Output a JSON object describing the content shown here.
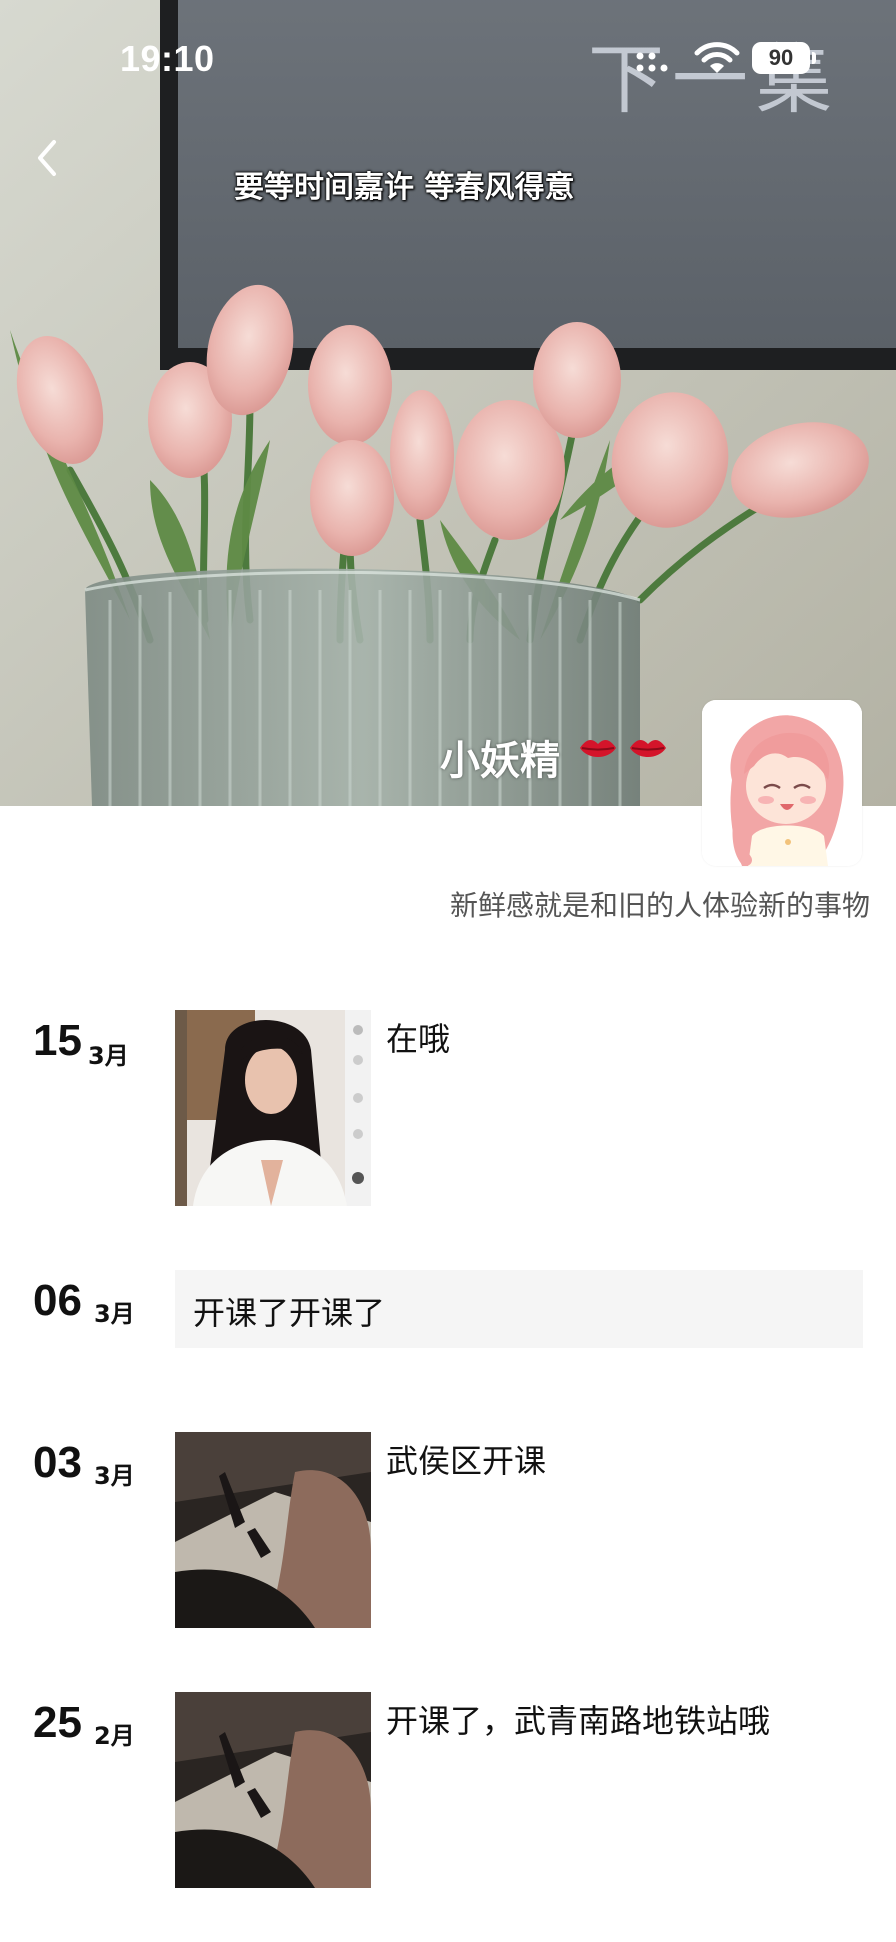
{
  "status_bar": {
    "time": "19:10",
    "battery": "90",
    "watermark": "下一集"
  },
  "cover": {
    "caption": "要等时间嘉许 等春风得意",
    "name": "小妖精"
  },
  "profile": {
    "signature": "新鲜感就是和旧的人体验新的事物"
  },
  "posts": [
    {
      "day": "15",
      "month": "3月",
      "text": "在哦",
      "type": "image"
    },
    {
      "day": "06",
      "month": "3月",
      "text": "开课了开课了",
      "type": "text"
    },
    {
      "day": "03",
      "month": "3月",
      "text": "武侯区开课",
      "type": "image"
    },
    {
      "day": "25",
      "month": "2月",
      "text": "开课了，武青南路地铁站哦",
      "type": "image"
    }
  ],
  "icons": [
    "back-icon",
    "signal-icon",
    "wifi-icon",
    "battery-icon",
    "lips-icon"
  ]
}
